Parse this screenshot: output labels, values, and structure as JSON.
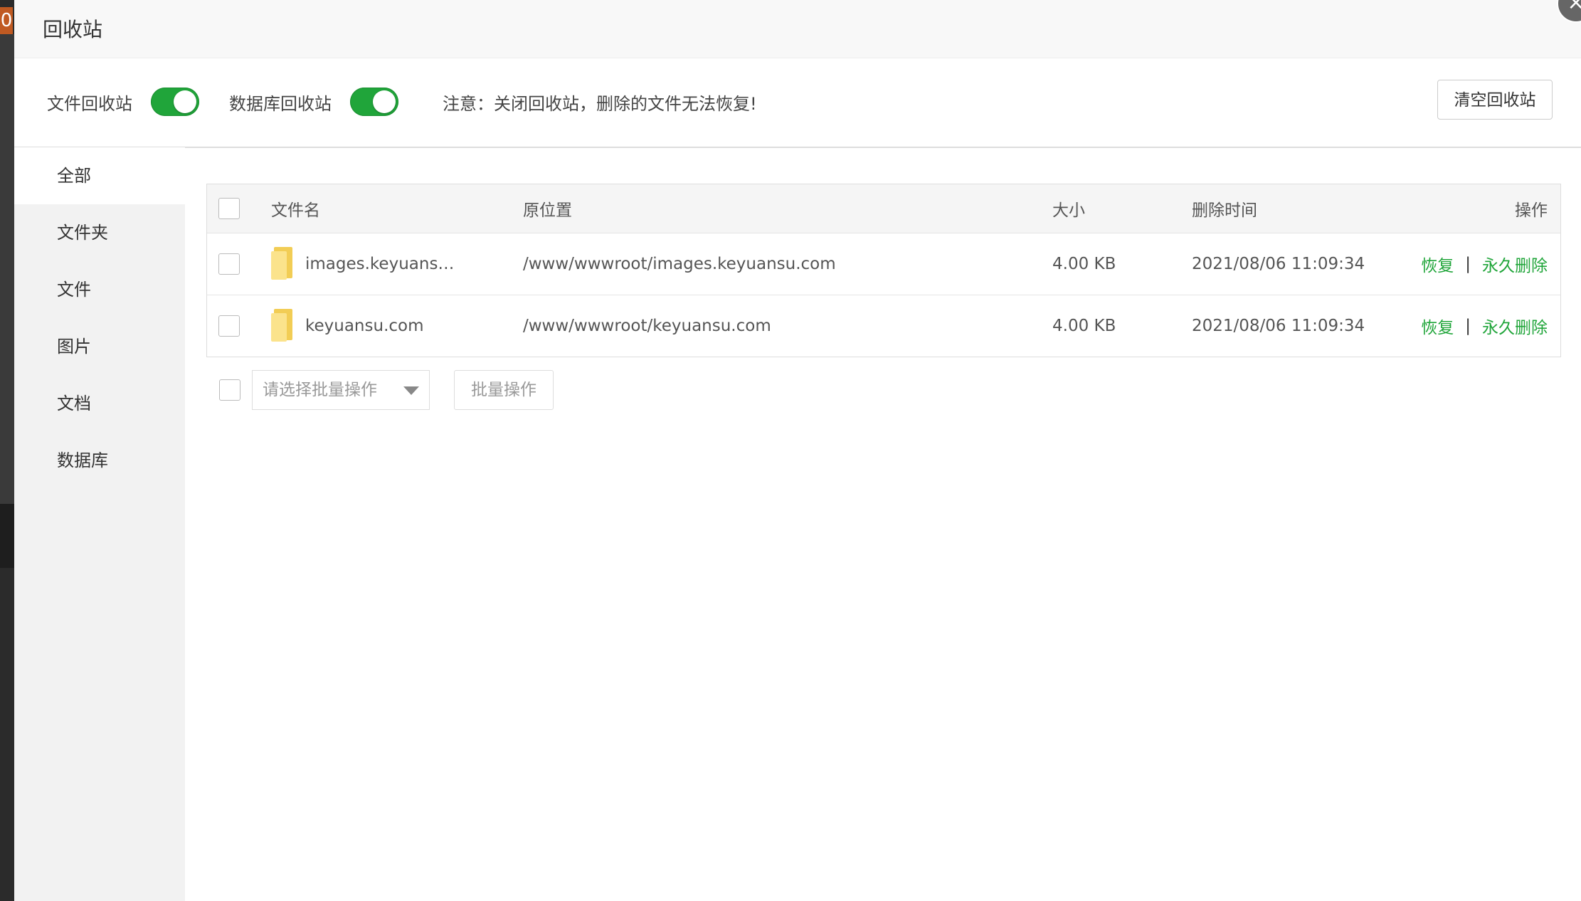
{
  "background_badge": "0",
  "dialog": {
    "title": "回收站",
    "close_icon": "×"
  },
  "toolbar": {
    "file_recycle_label": "文件回收站",
    "file_recycle_on": true,
    "db_recycle_label": "数据库回收站",
    "db_recycle_on": true,
    "notice": "注意：关闭回收站，删除的文件无法恢复!",
    "clear_button": "清空回收站"
  },
  "sidebar": {
    "items": [
      {
        "label": "全部",
        "active": true
      },
      {
        "label": "文件夹",
        "active": false
      },
      {
        "label": "文件",
        "active": false
      },
      {
        "label": "图片",
        "active": false
      },
      {
        "label": "文档",
        "active": false
      },
      {
        "label": "数据库",
        "active": false
      }
    ]
  },
  "table": {
    "columns": [
      "文件名",
      "原位置",
      "大小",
      "删除时间",
      "操作"
    ],
    "rows": [
      {
        "name": "images.keyuans…",
        "location": "/www/wwwroot/images.keyuansu.com",
        "size": "4.00 KB",
        "deleted_at": "2021/08/06 11:09:34",
        "restore": "恢复",
        "separator": "|",
        "delete": "永久删除"
      },
      {
        "name": "keyuansu.com",
        "location": "/www/wwwroot/keyuansu.com",
        "size": "4.00 KB",
        "deleted_at": "2021/08/06 11:09:34",
        "restore": "恢复",
        "separator": "|",
        "delete": "永久删除"
      }
    ]
  },
  "batch": {
    "select_placeholder": "请选择批量操作",
    "button": "批量操作"
  },
  "colors": {
    "accent": "#20a53a",
    "sidebar_bg": "#f2f2f2",
    "header_bg": "#f8f8f8"
  }
}
